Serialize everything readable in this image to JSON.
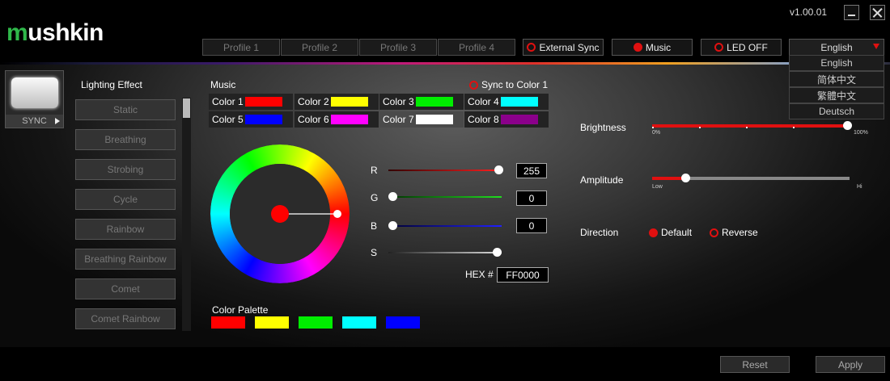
{
  "app": {
    "logo_prefix": "m",
    "logo_rest": "ushkin",
    "version": "v1.00.01"
  },
  "profiles": [
    "Profile 1",
    "Profile 2",
    "Profile 3",
    "Profile 4"
  ],
  "header_buttons": {
    "external_sync": "External Sync",
    "music": "Music",
    "led_off": "LED OFF"
  },
  "language": {
    "selected": "English",
    "options": [
      "English",
      "简体中文",
      "繁體中文",
      "Deutsch"
    ]
  },
  "device": {
    "label": "SYNC"
  },
  "lighting": {
    "title": "Lighting Effect",
    "effects": [
      "Static",
      "Breathing",
      "Strobing",
      "Cycle",
      "Rainbow",
      "Breathing Rainbow",
      "Comet",
      "Comet Rainbow"
    ]
  },
  "music": {
    "title": "Music",
    "sync_to_color1": "Sync to Color 1",
    "colors": [
      {
        "label": "Color 1",
        "swatch": "#ff0000"
      },
      {
        "label": "Color 2",
        "swatch": "#ffff00"
      },
      {
        "label": "Color 3",
        "swatch": "#00ee00"
      },
      {
        "label": "Color 4",
        "swatch": "#00ffff"
      },
      {
        "label": "Color 5",
        "swatch": "#0000ff"
      },
      {
        "label": "Color 6",
        "swatch": "#ff00ff"
      },
      {
        "label": "Color 7",
        "swatch": "#ffffff"
      },
      {
        "label": "Color 8",
        "swatch": "#8b008b"
      }
    ],
    "selected_color_index": 6
  },
  "rgb": {
    "r_label": "R",
    "g_label": "G",
    "b_label": "B",
    "s_label": "S",
    "r": "255",
    "g": "0",
    "b": "0",
    "s_level": 1.0,
    "hex_label": "HEX #",
    "hex": "FF0000"
  },
  "palette": {
    "title": "Color Palette",
    "colors": [
      "#ff0000",
      "#ffff00",
      "#00ee00",
      "#00ffff",
      "#0000ff"
    ]
  },
  "brightness": {
    "label": "Brightness",
    "min_label": "0%",
    "max_label": "100%",
    "level": 1.0
  },
  "amplitude": {
    "label": "Amplitude",
    "min_label": "Low",
    "max_label": "Hi",
    "level": 0.18
  },
  "direction": {
    "label": "Direction",
    "default": "Default",
    "reverse": "Reverse",
    "selected": "Default"
  },
  "footer": {
    "reset": "Reset",
    "apply": "Apply"
  },
  "accent": "#e01010"
}
